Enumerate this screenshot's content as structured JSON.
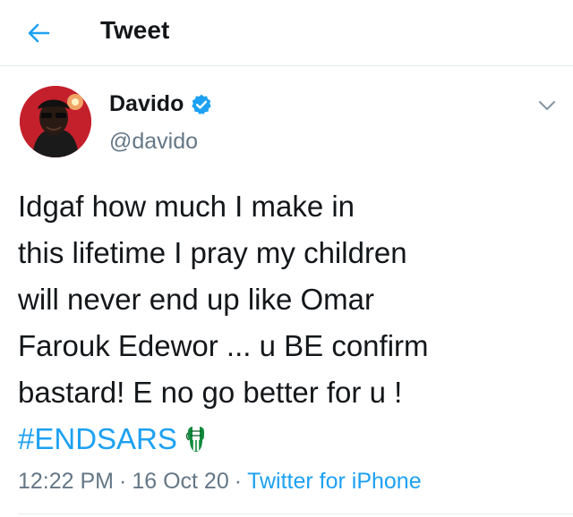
{
  "header": {
    "title": "Tweet"
  },
  "author": {
    "display_name": "Davido",
    "handle": "@davido",
    "verified": true
  },
  "tweet": {
    "lines": [
      "Idgaf how much I make in",
      "this lifetime I pray my children",
      "will never end up like Omar",
      "Farouk Edewor ... u BE confirm",
      "bastard! E no go better for u !"
    ],
    "hashtag": "#ENDSARS",
    "time": "12:22 PM",
    "date": "16 Oct 20",
    "source": "Twitter for iPhone",
    "separator": "·"
  },
  "colors": {
    "accent": "#1da1f2",
    "secondary_text": "#657786",
    "avatar_bg": "#c4202c"
  },
  "icons": {
    "back": "back-arrow-icon",
    "verified": "verified-badge-icon",
    "more": "chevron-down-icon",
    "emoji": "raised-fist-green-emoji"
  }
}
